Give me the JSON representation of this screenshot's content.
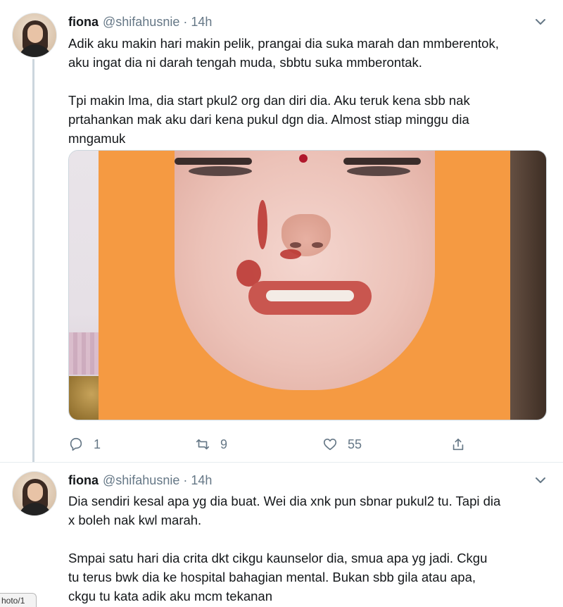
{
  "tweets": [
    {
      "name": "fiona",
      "handle": "@shifahusnie",
      "separator": "·",
      "time": "14h",
      "paragraphs": [
        "Adik aku makin hari makin pelik, prangai dia suka marah dan mmberentok,\naku ingat dia ni darah tengah muda, sbbtu suka mmberontak.",
        "Tpi makin lma, dia start pkul2 org dan diri dia. Aku teruk kena sbb nak\nprtahankan mak aku dari kena pukul dgn dia. Almost stiap minggu dia\nmngamuk"
      ],
      "actions": {
        "reply_count": "1",
        "retweet_count": "9",
        "like_count": "55"
      }
    },
    {
      "name": "fiona",
      "handle": "@shifahusnie",
      "separator": "·",
      "time": "14h",
      "paragraphs": [
        "Dia sendiri kesal apa yg dia buat. Wei dia xnk pun sbnar pukul2 tu. Tapi dia\nx boleh nak kwl marah.",
        "Smpai satu hari dia crita dkt cikgu kaunselor dia, smua apa yg jadi. Ckgu\ntu terus bwk dia ke hospital bahagian mental. Bukan sbb gila atau apa,\nckgu tu kata adik aku mcm tekanan"
      ]
    }
  ],
  "status_url": "hoto/1",
  "icons": {
    "caret": "chevron-down-icon",
    "reply": "reply-icon",
    "retweet": "retweet-icon",
    "like": "heart-icon",
    "share": "share-icon"
  },
  "colors": {
    "text": "#14171a",
    "muted": "#657786",
    "border": "#e6ecf0",
    "redaction": "#f59a42"
  }
}
